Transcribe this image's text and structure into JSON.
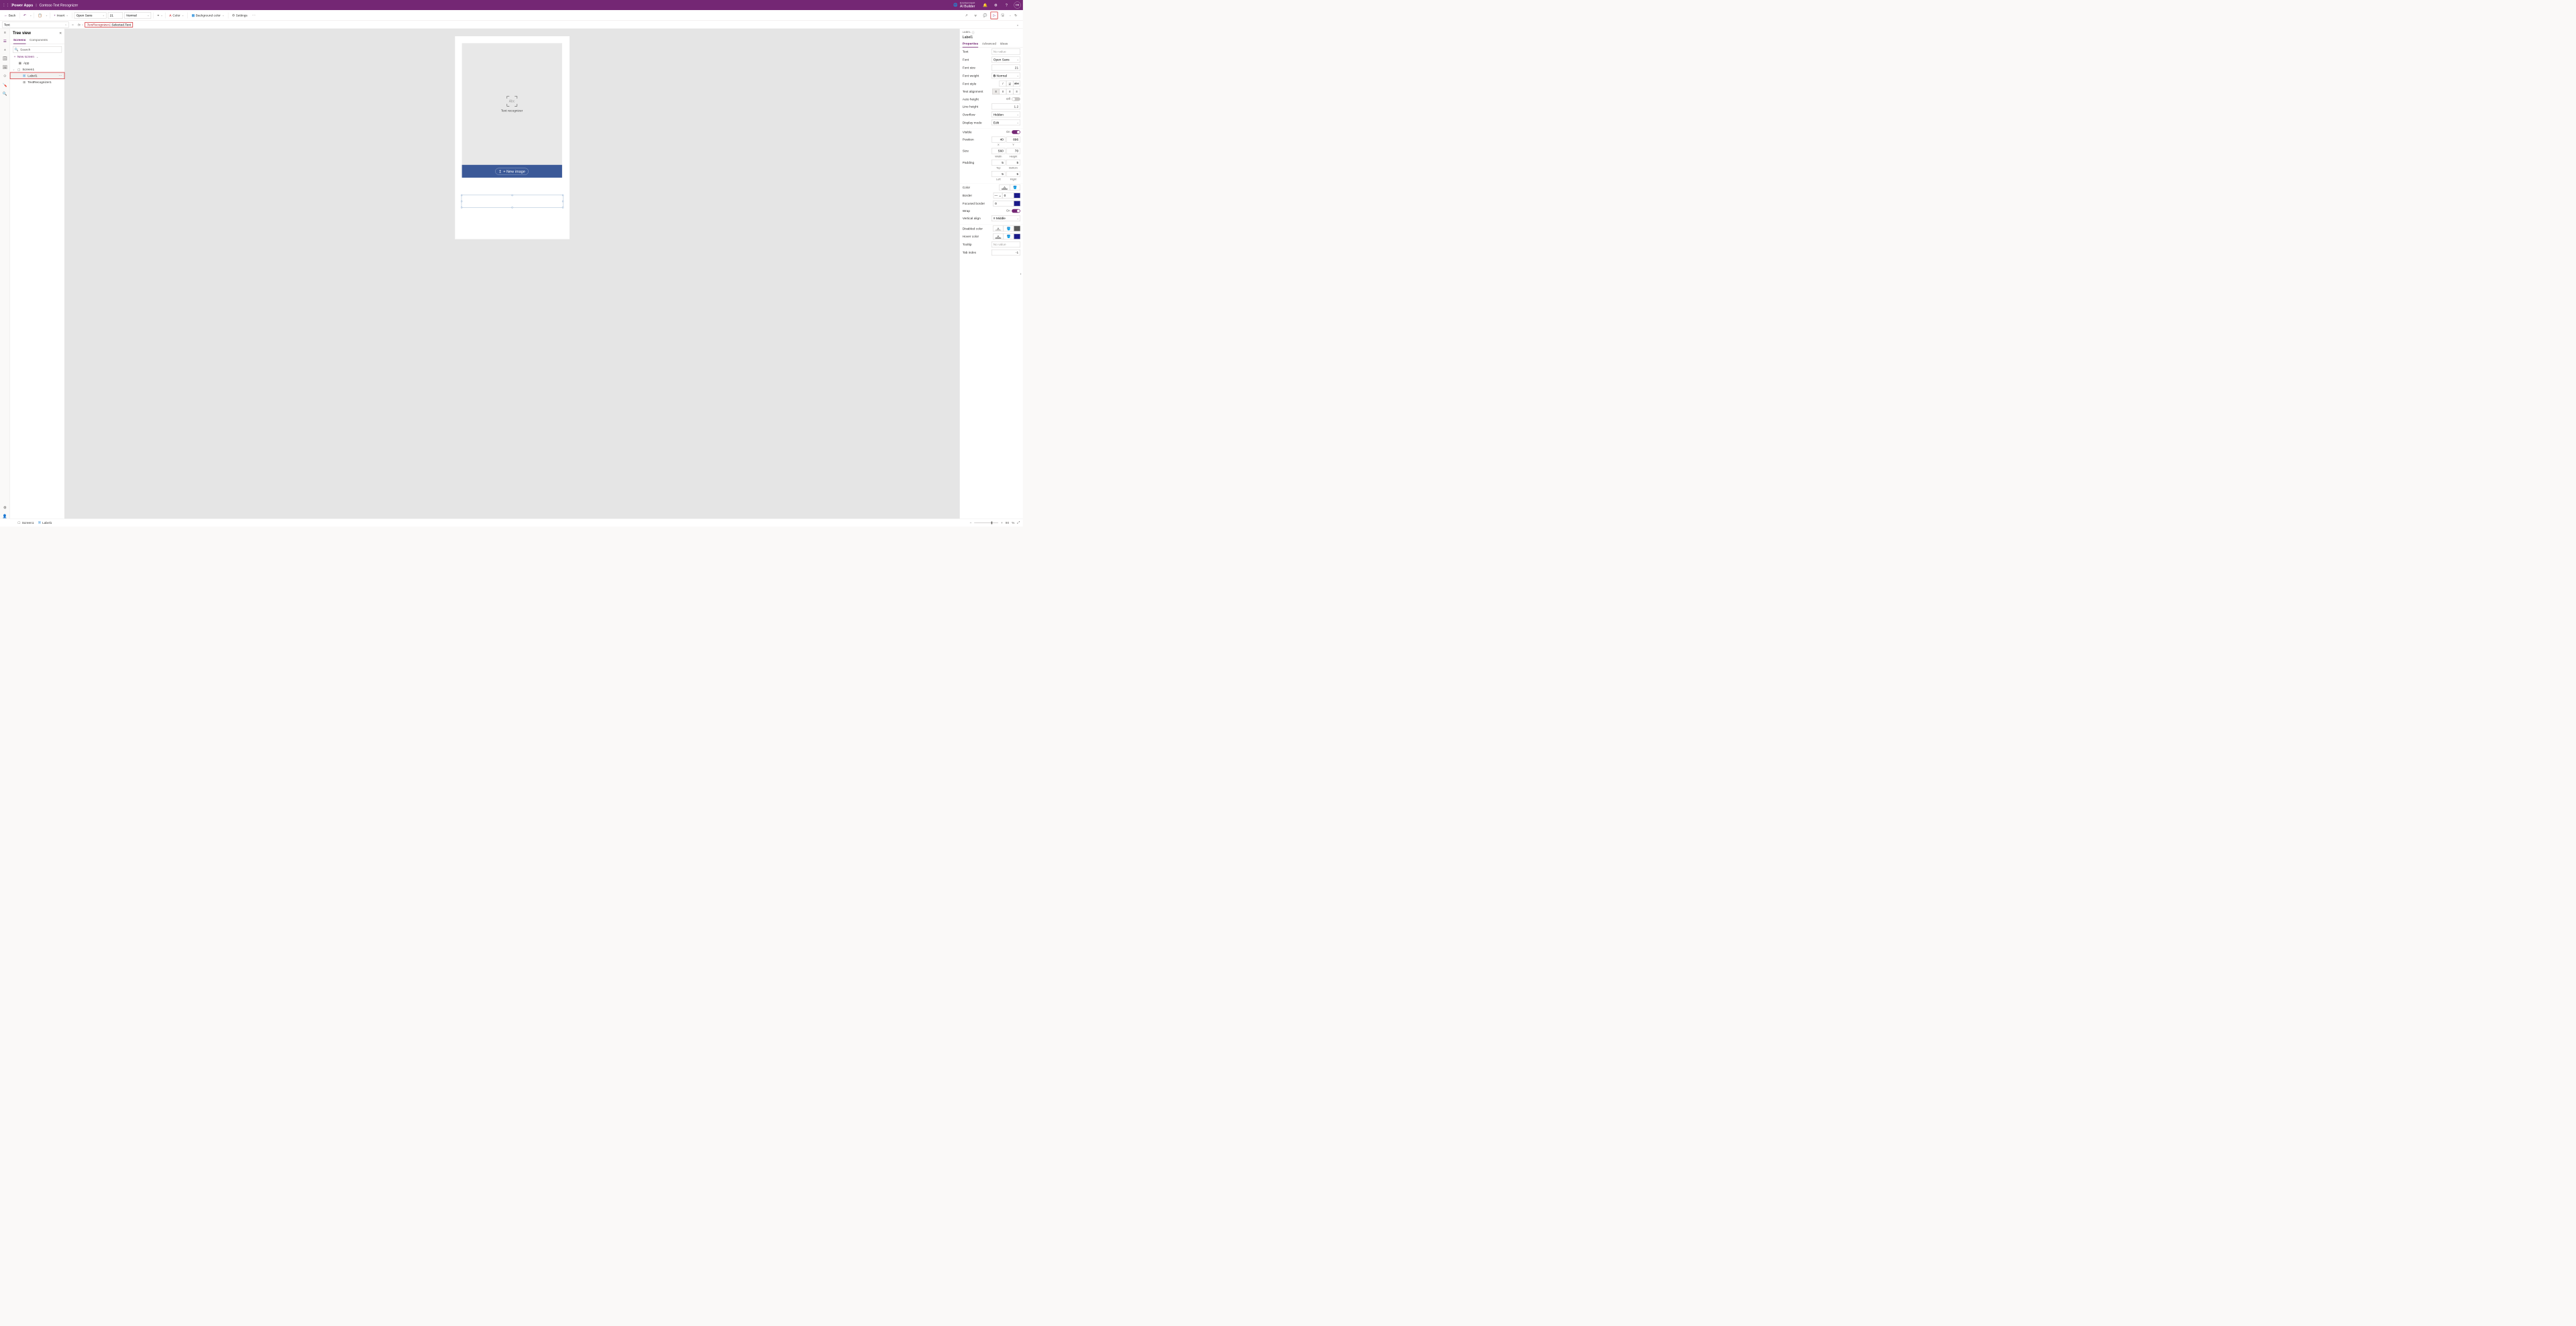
{
  "header": {
    "brand": "Power Apps",
    "appname": "Contoso Text Recognizer",
    "env_label": "Environment",
    "env_name": "AI Builder",
    "avatar": "DB"
  },
  "toolbar": {
    "back": "Back",
    "insert": "Insert",
    "font": "Open Sans",
    "size": "21",
    "weight": "Normal",
    "color": "Color",
    "bgcolor": "Background color",
    "settings": "Settings"
  },
  "formula": {
    "property": "Text",
    "fx": "fx",
    "expr_err": "TextRecognizer1",
    "expr_rest": ".Selected.Text"
  },
  "tree": {
    "title": "Tree view",
    "tab_screens": "Screens",
    "tab_components": "Components",
    "search_ph": "Search",
    "new_screen": "New screen",
    "app": "App",
    "screen": "Screen1",
    "label": "Label1",
    "recognizer": "TextRecognizer1"
  },
  "canvas": {
    "recognizer_caption": "Text recognizer",
    "scan_text": "Abc",
    "new_image": "+ New image"
  },
  "props": {
    "kind": "LABEL",
    "name": "Label1",
    "tab_props": "Properties",
    "tab_adv": "Advanced",
    "tab_ideas": "Ideas",
    "rows": {
      "text": "Text",
      "text_val": "No value",
      "font": "Font",
      "font_val": "Open Sans",
      "fontsize": "Font size",
      "fontsize_val": "21",
      "fontweight": "Font weight",
      "fontweight_val": "Normal",
      "fontstyle": "Font style",
      "textalign": "Text alignment",
      "autoheight": "Auto height",
      "autoheight_state": "Off",
      "lineheight": "Line height",
      "lineheight_val": "1.2",
      "overflow": "Overflow",
      "overflow_val": "Hidden",
      "displaymode": "Display mode",
      "displaymode_val": "Edit",
      "visible": "Visible",
      "visible_state": "On",
      "position": "Position",
      "pos_x": "40",
      "pos_y": "896",
      "sub_x": "X",
      "sub_y": "Y",
      "size": "Size",
      "size_w": "560",
      "size_h": "70",
      "sub_w": "Width",
      "sub_h": "Height",
      "padding": "Padding",
      "pad_t": "5",
      "pad_b": "5",
      "pad_l": "5",
      "pad_r": "5",
      "sub_t": "Top",
      "sub_bt": "Bottom",
      "sub_l": "Left",
      "sub_r": "Right",
      "color": "Color",
      "border": "Border",
      "border_val": "0",
      "focusedborder": "Focused border",
      "focusedborder_val": "0",
      "wrap": "Wrap",
      "wrap_state": "On",
      "valign": "Vertical align",
      "valign_val": "Middle",
      "disabledcolor": "Disabled color",
      "hovercolor": "Hover color",
      "tooltip": "Tooltip",
      "tooltip_val": "No value",
      "tabindex": "Tab index",
      "tabindex_val": "-1"
    }
  },
  "status": {
    "screen": "Screen1",
    "label": "Label1",
    "zoom": "90",
    "pct": "%"
  }
}
